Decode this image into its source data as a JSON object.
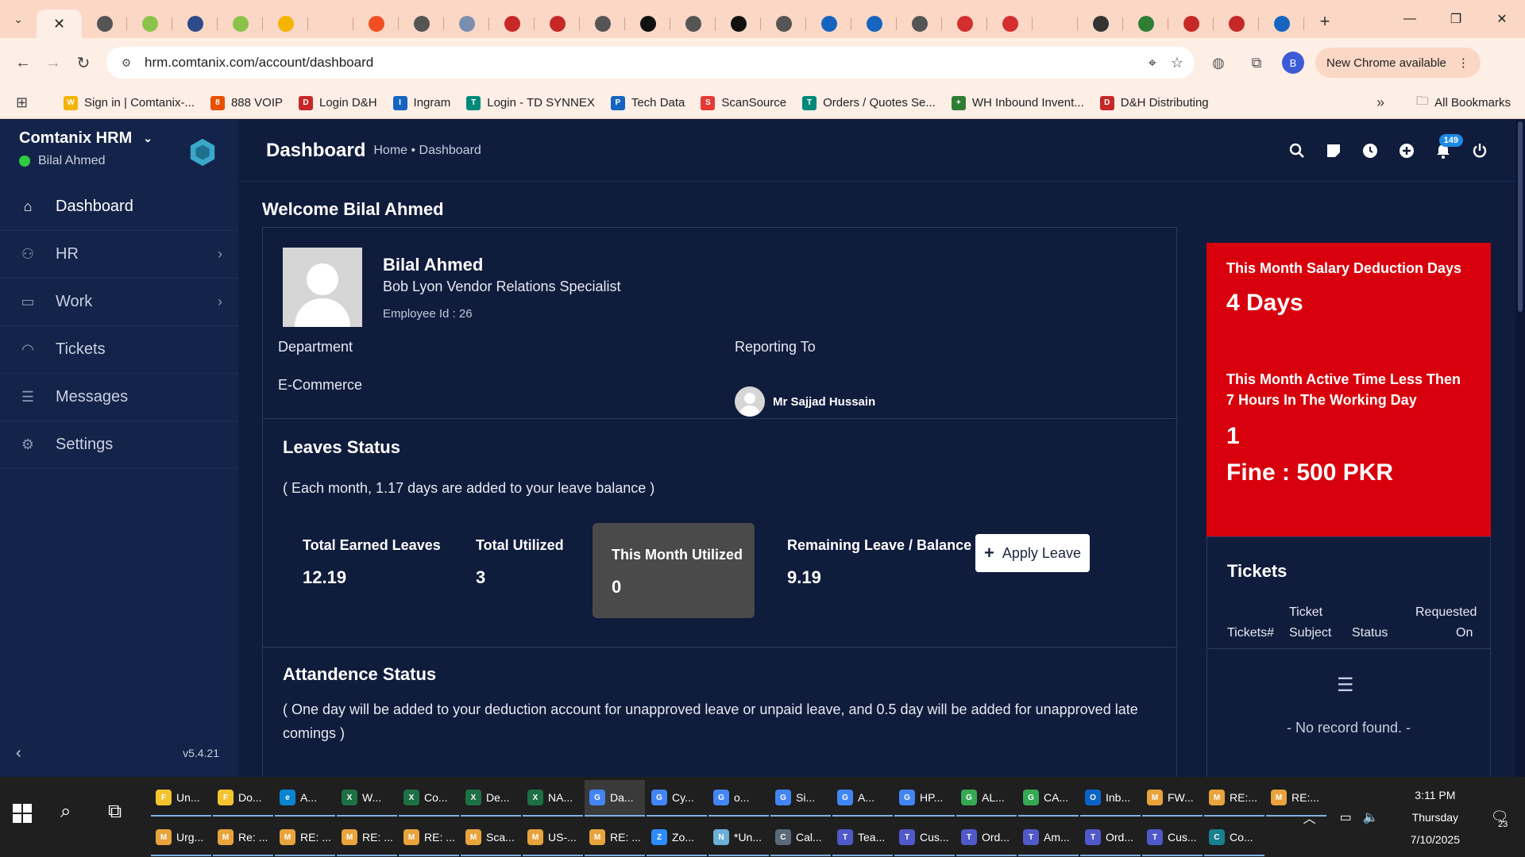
{
  "browser": {
    "tabs": [
      {
        "icon": "chevron-down",
        "color": "#333"
      },
      {
        "icon": "close",
        "color": "#222",
        "active": true
      },
      {
        "icon": "target",
        "color": "#555"
      },
      {
        "icon": "a-logo",
        "color": "#8bc34a"
      },
      {
        "icon": "rocket",
        "color": "#2d4a8a"
      },
      {
        "icon": "a-logo",
        "color": "#8bc34a"
      },
      {
        "icon": "slides",
        "color": "#f4b400"
      },
      {
        "icon": "blank",
        "color": "transparent"
      },
      {
        "icon": "ms-grid",
        "color": "#f25022"
      },
      {
        "icon": "globe",
        "color": "#555"
      },
      {
        "icon": "doc",
        "color": "#7a8fb0"
      },
      {
        "icon": "play-red",
        "color": "#c62828"
      },
      {
        "icon": "play-red",
        "color": "#c62828"
      },
      {
        "icon": "globe",
        "color": "#555"
      },
      {
        "icon": "s-logo",
        "color": "#111"
      },
      {
        "icon": "globe",
        "color": "#555"
      },
      {
        "icon": "hp-logo",
        "color": "#111"
      },
      {
        "icon": "globe",
        "color": "#555"
      },
      {
        "icon": "chevron-blue",
        "color": "#1565c0"
      },
      {
        "icon": "a-blue",
        "color": "#1565c0"
      },
      {
        "icon": "globe",
        "color": "#555"
      },
      {
        "icon": "shield-red",
        "color": "#d32f2f"
      },
      {
        "icon": "shield-red",
        "color": "#d32f2f"
      },
      {
        "icon": "blank",
        "color": "transparent"
      },
      {
        "icon": "im-logo",
        "color": "#333"
      },
      {
        "icon": "green-box",
        "color": "#2e7d32"
      },
      {
        "icon": "play-red",
        "color": "#c62828"
      },
      {
        "icon": "play-red",
        "color": "#c62828"
      },
      {
        "icon": "chevron-blue",
        "color": "#1565c0"
      }
    ],
    "url": "hrm.comtanix.com/account/dashboard",
    "profile_initial": "B",
    "update_label": "New Chrome available",
    "bookmarks": [
      {
        "label": "Sign in | Comtanix-...",
        "color": "#f4b400",
        "glyph": "W"
      },
      {
        "label": "888 VOIP",
        "color": "#e65100",
        "glyph": "8"
      },
      {
        "label": "Login D&H",
        "color": "#c62828",
        "glyph": "D"
      },
      {
        "label": "Ingram",
        "color": "#1565c0",
        "glyph": "I"
      },
      {
        "label": "Login - TD SYNNEX",
        "color": "#00897b",
        "glyph": "T"
      },
      {
        "label": "Tech Data",
        "color": "#1565c0",
        "glyph": "P"
      },
      {
        "label": "ScanSource",
        "color": "#e53935",
        "glyph": "S"
      },
      {
        "label": "Orders / Quotes Se...",
        "color": "#00897b",
        "glyph": "T"
      },
      {
        "label": "WH Inbound Invent...",
        "color": "#2e7d32",
        "glyph": "+"
      },
      {
        "label": "D&H Distributing",
        "color": "#c62828",
        "glyph": "D"
      }
    ],
    "all_bookmarks": "All Bookmarks"
  },
  "sidebar": {
    "brand": "Comtanix HRM",
    "user": "Bilal Ahmed",
    "items": [
      {
        "label": "Dashboard",
        "icon": "home-icon",
        "active": true,
        "submenu": false
      },
      {
        "label": "HR",
        "icon": "users-icon",
        "active": false,
        "submenu": true
      },
      {
        "label": "Work",
        "icon": "briefcase-icon",
        "active": false,
        "submenu": true
      },
      {
        "label": "Tickets",
        "icon": "headset-icon",
        "active": false,
        "submenu": false
      },
      {
        "label": "Messages",
        "icon": "message-icon",
        "active": false,
        "submenu": false
      },
      {
        "label": "Settings",
        "icon": "gear-icon",
        "active": false,
        "submenu": false
      }
    ],
    "version": "v5.4.21"
  },
  "header": {
    "title": "Dashboard",
    "breadcrumb": "Home • Dashboard",
    "notification_count": "149"
  },
  "main": {
    "welcome": "Welcome Bilal Ahmed",
    "employee": {
      "name": "Bilal Ahmed",
      "role": "Bob Lyon Vendor Relations Specialist",
      "id_text": "Employee Id : 26",
      "department_label": "Department",
      "department": "E-Commerce",
      "reporting_label": "Reporting To",
      "reporting_to": "Mr Sajjad Hussain"
    },
    "leaves": {
      "title": "Leaves Status",
      "note": "( Each month, 1.17 days are added to your leave balance )",
      "earned_label": "Total Earned Leaves",
      "earned": "12.19",
      "utilized_label": "Total Utilized",
      "utilized": "3",
      "month_label": "This Month Utilized",
      "month": "0",
      "remaining_label": "Remaining Leave / Balance",
      "remaining": "9.19",
      "apply_label": "Apply Leave"
    },
    "attendance": {
      "title": "Attandence Status",
      "note_line1": "( One day will be added to your deduction account for unapproved leave or unpaid leave, and 0.5 day will be added for unapproved late",
      "note_line2": "comings )"
    },
    "deduction": {
      "label1": "This Month Salary Deduction Days",
      "value1": "4 Days",
      "label2": "This Month Active Time Less Then 7 Hours In The Working Day",
      "value2": "1",
      "fine": "Fine : 500 PKR",
      "bg": "#d8000c"
    },
    "tickets": {
      "title": "Tickets",
      "col1": "Tickets#",
      "col2a": "Ticket",
      "col2b": "Subject",
      "col3": "Status",
      "col4a": "Requested",
      "col4b": "On",
      "empty": "- No record found. -"
    }
  },
  "taskbar": {
    "row1": [
      {
        "label": "Un...",
        "color": "#f4c430",
        "glyph": "F"
      },
      {
        "label": "Do...",
        "color": "#f4c430",
        "glyph": "F"
      },
      {
        "label": "A...",
        "color": "#0a84d0",
        "glyph": "e"
      },
      {
        "label": "W...",
        "color": "#1d7044",
        "glyph": "X"
      },
      {
        "label": "Co...",
        "color": "#1d7044",
        "glyph": "X"
      },
      {
        "label": "De...",
        "color": "#1d7044",
        "glyph": "X"
      },
      {
        "label": "NA...",
        "color": "#1d7044",
        "glyph": "X"
      },
      {
        "label": "Da...",
        "color": "#4285f4",
        "glyph": "G",
        "active": true
      },
      {
        "label": "Cy...",
        "color": "#4285f4",
        "glyph": "G"
      },
      {
        "label": "o...",
        "color": "#4285f4",
        "glyph": "G"
      },
      {
        "label": "Si...",
        "color": "#4285f4",
        "glyph": "G"
      },
      {
        "label": "A...",
        "color": "#4285f4",
        "glyph": "G"
      },
      {
        "label": "HP...",
        "color": "#4285f4",
        "glyph": "G"
      },
      {
        "label": "AL...",
        "color": "#34a853",
        "glyph": "G"
      },
      {
        "label": "CA...",
        "color": "#34a853",
        "glyph": "G"
      },
      {
        "label": "Inb...",
        "color": "#0a64c8",
        "glyph": "O"
      },
      {
        "label": "FW...",
        "color": "#e8a33c",
        "glyph": "M"
      },
      {
        "label": "RE:...",
        "color": "#e8a33c",
        "glyph": "M"
      },
      {
        "label": "RE:...",
        "color": "#e8a33c",
        "glyph": "M"
      }
    ],
    "row2": [
      {
        "label": "Urg...",
        "color": "#e8a33c",
        "glyph": "M"
      },
      {
        "label": "Re: ...",
        "color": "#e8a33c",
        "glyph": "M"
      },
      {
        "label": "RE: ...",
        "color": "#e8a33c",
        "glyph": "M"
      },
      {
        "label": "RE: ...",
        "color": "#e8a33c",
        "glyph": "M"
      },
      {
        "label": "RE: ...",
        "color": "#e8a33c",
        "glyph": "M"
      },
      {
        "label": "Sca...",
        "color": "#e8a33c",
        "glyph": "M"
      },
      {
        "label": "US-...",
        "color": "#e8a33c",
        "glyph": "M"
      },
      {
        "label": "RE: ...",
        "color": "#e8a33c",
        "glyph": "M"
      },
      {
        "label": "Zo...",
        "color": "#2d8cff",
        "glyph": "Z"
      },
      {
        "label": "*Un...",
        "color": "#6ab0d8",
        "glyph": "N"
      },
      {
        "label": "Cal...",
        "color": "#5a6a7a",
        "glyph": "C"
      },
      {
        "label": "Tea...",
        "color": "#5059c9",
        "glyph": "T"
      },
      {
        "label": "Cus...",
        "color": "#5059c9",
        "glyph": "T"
      },
      {
        "label": "Ord...",
        "color": "#5059c9",
        "glyph": "T"
      },
      {
        "label": "Am...",
        "color": "#5059c9",
        "glyph": "T"
      },
      {
        "label": "Ord...",
        "color": "#5059c9",
        "glyph": "T"
      },
      {
        "label": "Cus...",
        "color": "#5059c9",
        "glyph": "T"
      },
      {
        "label": "Co...",
        "color": "#1a7f8e",
        "glyph": "C"
      }
    ],
    "time": "3:11 PM",
    "day": "Thursday",
    "date": "7/10/2025",
    "notification_count": "23"
  }
}
